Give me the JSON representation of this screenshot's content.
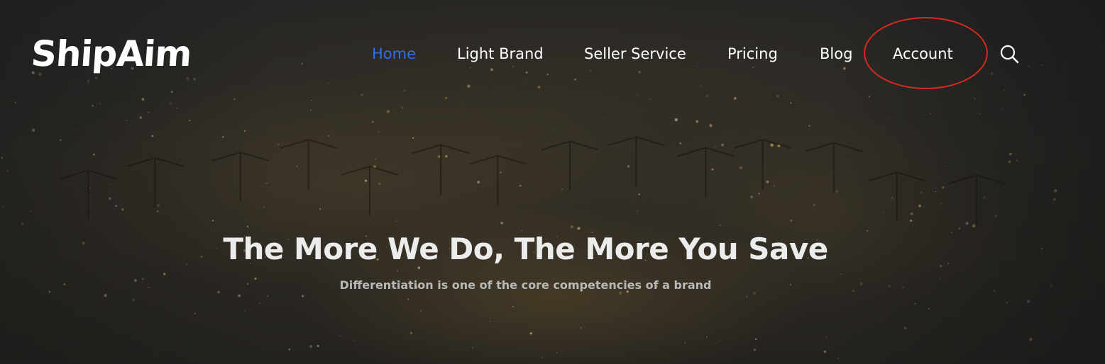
{
  "brand": {
    "logo_text": "ShipAim"
  },
  "nav": {
    "items": [
      {
        "label": "Home",
        "active": true
      },
      {
        "label": "Light Brand",
        "active": false
      },
      {
        "label": "Seller Service",
        "active": false
      },
      {
        "label": "Pricing",
        "active": false
      },
      {
        "label": "Blog",
        "active": false
      },
      {
        "label": "Account",
        "active": false,
        "highlighted": true
      }
    ],
    "search_icon": "search-icon"
  },
  "hero": {
    "title": "The More We Do, The More You Save",
    "subtitle": "Differentiation is one of the core competencies of a brand",
    "background": "night-port-aerial-photo"
  },
  "colors": {
    "active_nav": "#2f6fe8",
    "nav_text": "#ffffff",
    "highlight_ring": "#d62a1f",
    "title_text": "#ececec",
    "subtitle_text": "#b9b9b9"
  }
}
